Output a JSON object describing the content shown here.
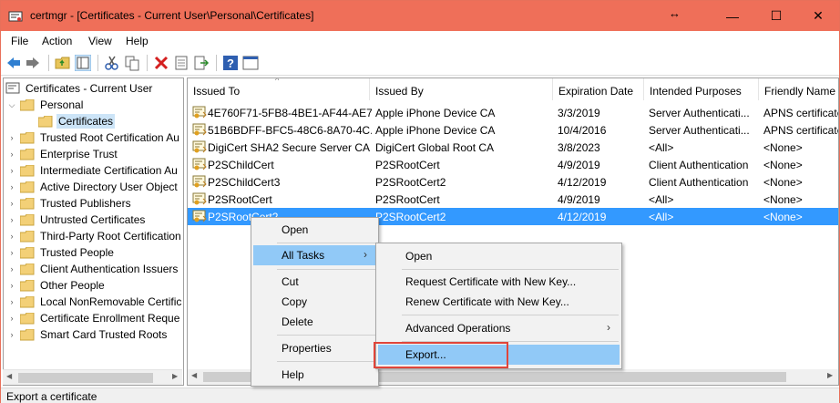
{
  "window": {
    "title": "certmgr - [Certificates - Current User\\Personal\\Certificates]",
    "resize_glyph": "↔",
    "minimize": "—",
    "maximize": "☐",
    "close": "✕"
  },
  "menubar": {
    "items": [
      "File",
      "Action",
      "View",
      "Help"
    ]
  },
  "toolbar": {
    "icons": [
      "back-arrow-icon",
      "forward-arrow-icon",
      "up-folder-icon",
      "show-hide-tree-icon",
      "cut-icon",
      "copy-icon",
      "delete-icon",
      "properties-icon",
      "refresh-icon",
      "export-list-icon",
      "help-icon",
      "console-icon"
    ]
  },
  "tree": {
    "root": "Certificates - Current User",
    "items": [
      {
        "label": "Personal",
        "expanded": true
      },
      {
        "label": "Certificates",
        "selected": true
      },
      {
        "label": "Trusted Root Certification Au"
      },
      {
        "label": "Enterprise Trust"
      },
      {
        "label": "Intermediate Certification Au"
      },
      {
        "label": "Active Directory User Object"
      },
      {
        "label": "Trusted Publishers"
      },
      {
        "label": "Untrusted Certificates"
      },
      {
        "label": "Third-Party Root Certification"
      },
      {
        "label": "Trusted People"
      },
      {
        "label": "Client Authentication Issuers"
      },
      {
        "label": "Other People"
      },
      {
        "label": "Local NonRemovable Certific"
      },
      {
        "label": "Certificate Enrollment Reque"
      },
      {
        "label": "Smart Card Trusted Roots"
      }
    ]
  },
  "list": {
    "columns": [
      "Issued To",
      "Issued By",
      "Expiration Date",
      "Intended Purposes",
      "Friendly Name"
    ],
    "rows": [
      [
        "4E760F71-5FB8-4BE1-AF44-AE7...",
        "Apple iPhone Device CA",
        "3/3/2019",
        "Server Authenticati...",
        "APNS certificate"
      ],
      [
        "51B6BDFF-BFC5-48C6-8A70-4C...",
        "Apple iPhone Device CA",
        "10/4/2016",
        "Server Authenticati...",
        "APNS certificate"
      ],
      [
        "DigiCert SHA2 Secure Server CA",
        "DigiCert Global Root CA",
        "3/8/2023",
        "<All>",
        "<None>"
      ],
      [
        "P2SChildCert",
        "P2SRootCert",
        "4/9/2019",
        "Client Authentication",
        "<None>"
      ],
      [
        "P2SChildCert3",
        "P2SRootCert2",
        "4/12/2019",
        "Client Authentication",
        "<None>"
      ],
      [
        "P2SRootCert",
        "P2SRootCert",
        "4/9/2019",
        "<All>",
        "<None>"
      ],
      [
        "P2SRootCert2",
        "P2SRootCert2",
        "4/12/2019",
        "<All>",
        "<None>"
      ]
    ],
    "selected_row": 6
  },
  "context_menu": {
    "open": "Open",
    "all_tasks": "All Tasks",
    "cut": "Cut",
    "copy": "Copy",
    "delete": "Delete",
    "properties": "Properties",
    "help": "Help",
    "submenu_arrow": "›"
  },
  "submenu": {
    "open": "Open",
    "request_new_key": "Request Certificate with New Key...",
    "renew_new_key": "Renew Certificate with New Key...",
    "advanced": "Advanced Operations",
    "export": "Export...",
    "submenu_arrow": "›"
  },
  "statusbar": {
    "text": "Export a certificate"
  },
  "colors": {
    "titlebar": "#ef6f59",
    "selection": "#3399ff",
    "menu_highlight": "#91c9f7",
    "callout": "#e0453a"
  }
}
